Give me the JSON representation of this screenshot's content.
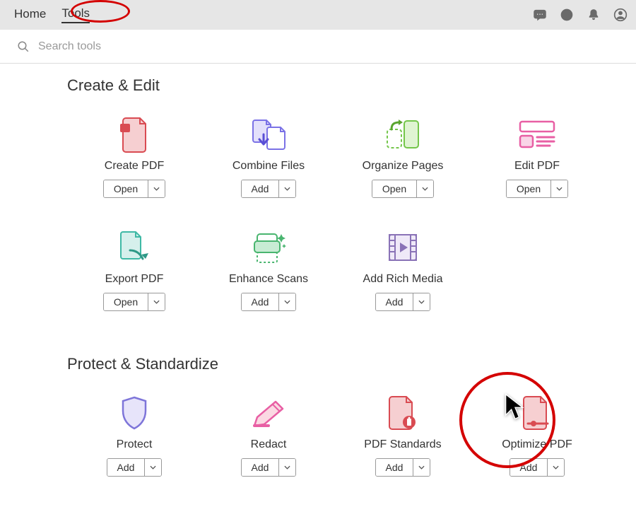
{
  "nav": {
    "home": "Home",
    "tools": "Tools"
  },
  "search": {
    "placeholder": "Search tools"
  },
  "sections": {
    "create_edit": "Create & Edit",
    "protect_standardize": "Protect & Standardize"
  },
  "btn": {
    "open": "Open",
    "add": "Add"
  },
  "tools": {
    "create_pdf": "Create PDF",
    "combine_files": "Combine Files",
    "organize_pages": "Organize Pages",
    "edit_pdf": "Edit PDF",
    "export_pdf": "Export PDF",
    "enhance_scans": "Enhance Scans",
    "add_rich_media": "Add Rich Media",
    "protect": "Protect",
    "redact": "Redact",
    "pdf_standards": "PDF Standards",
    "optimize_pdf": "Optimize PDF"
  }
}
